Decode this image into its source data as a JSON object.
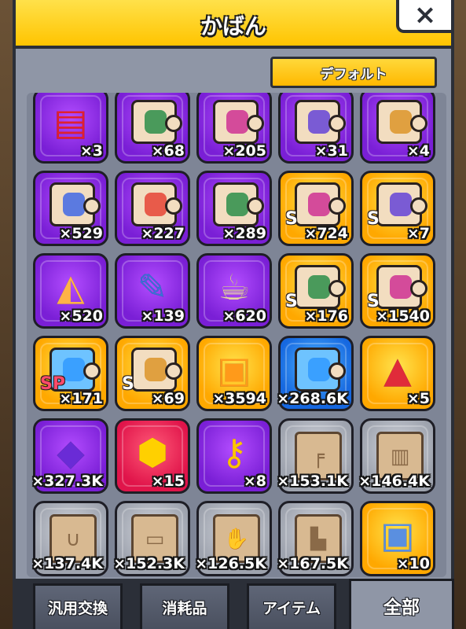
{
  "window": {
    "title": "かばん",
    "close_label": "×"
  },
  "filter": {
    "label": "デフォルト"
  },
  "colors": {
    "header": "#ffc400",
    "panel": "#8f96a6",
    "purple": "#8a2be2",
    "gold": "#ffb800"
  },
  "items": [
    {
      "icon": "red-card-book-icon",
      "rarity": "purple",
      "qty": "×3"
    },
    {
      "icon": "puzzle-piece-hero-icon",
      "rarity": "purple",
      "qty": "×68"
    },
    {
      "icon": "puzzle-piece-hero-icon",
      "rarity": "purple",
      "qty": "×205"
    },
    {
      "icon": "puzzle-piece-hero-icon",
      "rarity": "purple",
      "qty": "×31"
    },
    {
      "icon": "puzzle-piece-hero-icon",
      "rarity": "purple",
      "qty": "×4"
    },
    {
      "icon": "puzzle-piece-hero-icon",
      "rarity": "purple",
      "qty": "×529"
    },
    {
      "icon": "puzzle-piece-hero-icon",
      "rarity": "purple",
      "qty": "×227"
    },
    {
      "icon": "puzzle-piece-hero-icon",
      "rarity": "purple",
      "qty": "×289"
    },
    {
      "icon": "puzzle-piece-s-hero-icon",
      "rarity": "gold",
      "qty": "×724"
    },
    {
      "icon": "puzzle-piece-s-hero-icon",
      "rarity": "gold",
      "qty": "×7"
    },
    {
      "icon": "pizza-icon",
      "rarity": "purple",
      "qty": "×520"
    },
    {
      "icon": "microphone-book-icon",
      "rarity": "purple",
      "qty": "×139"
    },
    {
      "icon": "teapot-icon",
      "rarity": "purple",
      "qty": "×620"
    },
    {
      "icon": "puzzle-piece-s-hero-icon",
      "rarity": "gold",
      "qty": "×176"
    },
    {
      "icon": "puzzle-piece-s-hero-icon",
      "rarity": "gold",
      "qty": "×1540"
    },
    {
      "icon": "puzzle-piece-sp-blue-icon",
      "rarity": "gold",
      "qty": "×171"
    },
    {
      "icon": "puzzle-piece-s-hero-icon",
      "rarity": "gold",
      "qty": "×69"
    },
    {
      "icon": "gold-chest-icon",
      "rarity": "gold",
      "qty": "×3594"
    },
    {
      "icon": "puzzle-piece-blue-circuit-icon",
      "rarity": "blue",
      "qty": "×268.6K"
    },
    {
      "icon": "red-crystal-orb-icon",
      "rarity": "gold",
      "qty": "×5"
    },
    {
      "icon": "purple-gem-icon",
      "rarity": "purple",
      "qty": "×327.3K"
    },
    {
      "icon": "yellow-gem-icon",
      "rarity": "red",
      "qty": "×15"
    },
    {
      "icon": "gold-key-icon",
      "rarity": "purple",
      "qty": "×8"
    },
    {
      "icon": "gun-blueprint-icon",
      "rarity": "gray",
      "qty": "×153.1K"
    },
    {
      "icon": "armor-blueprint-icon",
      "rarity": "gray",
      "qty": "×146.4K"
    },
    {
      "icon": "necklace-blueprint-icon",
      "rarity": "gray",
      "qty": "×137.4K"
    },
    {
      "icon": "belt-blueprint-icon",
      "rarity": "gray",
      "qty": "×152.3K"
    },
    {
      "icon": "glove-blueprint-icon",
      "rarity": "gray",
      "qty": "×126.5K"
    },
    {
      "icon": "boot-blueprint-icon",
      "rarity": "gray",
      "qty": "×167.5K"
    },
    {
      "icon": "gold-chest-small-icon",
      "rarity": "gold",
      "qty": "×10"
    }
  ],
  "tabs": [
    {
      "label": "汎用交換",
      "active": false
    },
    {
      "label": "消耗品",
      "active": false
    },
    {
      "label": "アイテム",
      "active": false
    },
    {
      "label": "全部",
      "active": true
    }
  ]
}
